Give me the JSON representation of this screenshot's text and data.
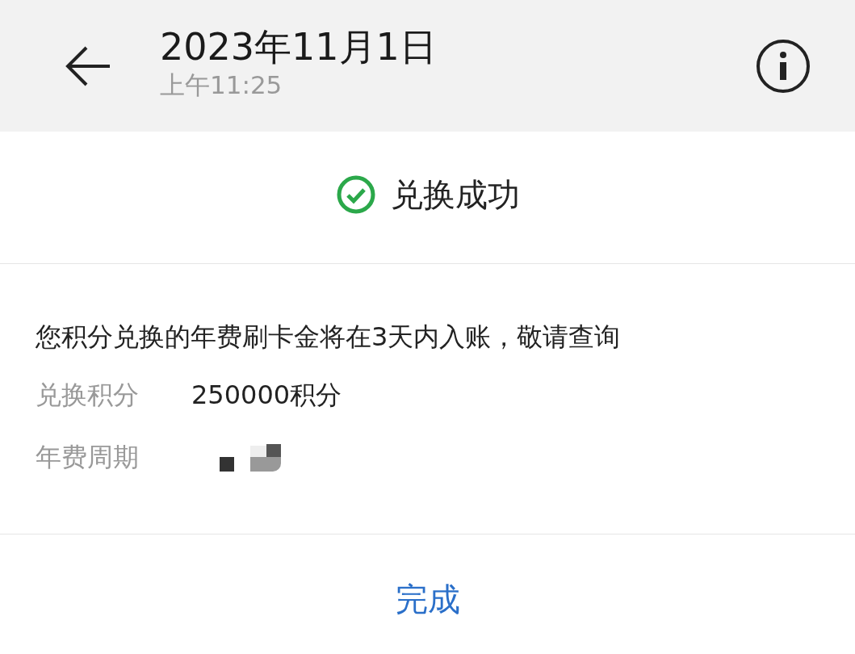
{
  "header": {
    "title": "2023年11月1日",
    "subtitle": "上午11:25"
  },
  "status": {
    "text": "兑换成功"
  },
  "message": "您积分兑换的年费刷卡金将在3天内入账，敬请查询",
  "details": [
    {
      "label": "兑换积分",
      "value": "250000积分",
      "kind": "text"
    },
    {
      "label": "年费周期",
      "kind": "redacted"
    }
  ],
  "done_button": "完成"
}
